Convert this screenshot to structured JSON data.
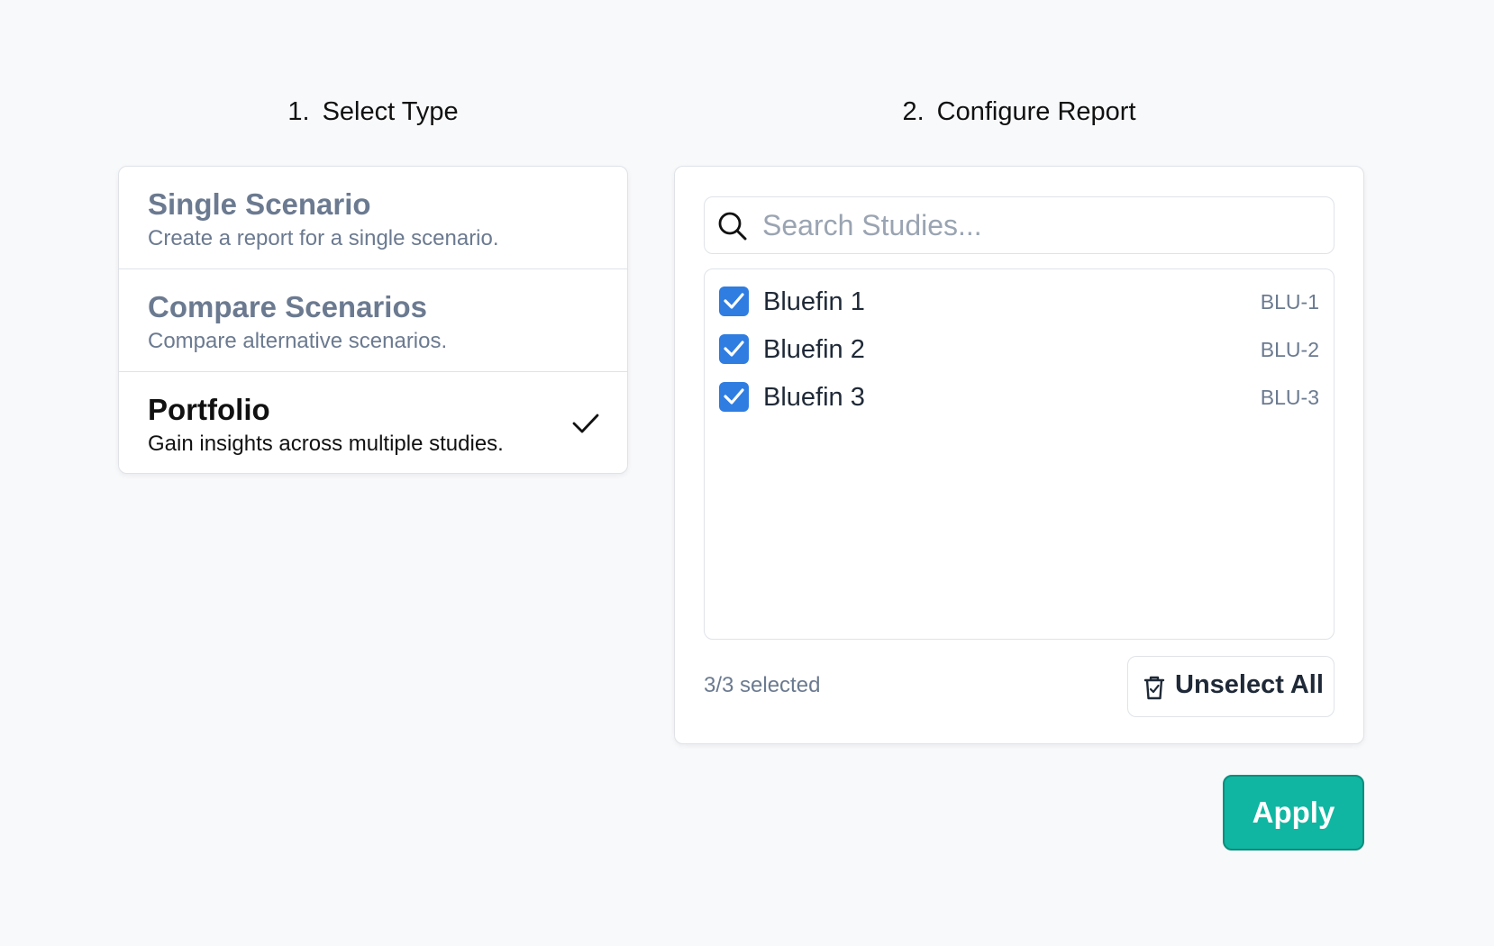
{
  "steps": [
    {
      "number": "1.",
      "title": "Select Type"
    },
    {
      "number": "2.",
      "title": "Configure Report"
    }
  ],
  "report_types": [
    {
      "name": "Single Scenario",
      "description": "Create a report for a single scenario.",
      "selected": false
    },
    {
      "name": "Compare Scenarios",
      "description": "Compare alternative scenarios.",
      "selected": false
    },
    {
      "name": "Portfolio",
      "description": "Gain insights across multiple studies.",
      "selected": true
    }
  ],
  "search": {
    "placeholder": "Search Studies...",
    "value": ""
  },
  "studies": [
    {
      "name": "Bluefin 1",
      "code": "BLU-1",
      "checked": true
    },
    {
      "name": "Bluefin 2",
      "code": "BLU-2",
      "checked": true
    },
    {
      "name": "Bluefin 3",
      "code": "BLU-3",
      "checked": true
    }
  ],
  "selection_count": "3/3 selected",
  "unselect_all_label": "Unselect All",
  "apply_label": "Apply",
  "colors": {
    "accent": "#10b6a1",
    "checkbox": "#2f7de1",
    "muted_text": "#6b7a90"
  },
  "icons": {
    "search": "search-icon",
    "selected_check": "check-icon",
    "unselect": "trash-icon"
  }
}
